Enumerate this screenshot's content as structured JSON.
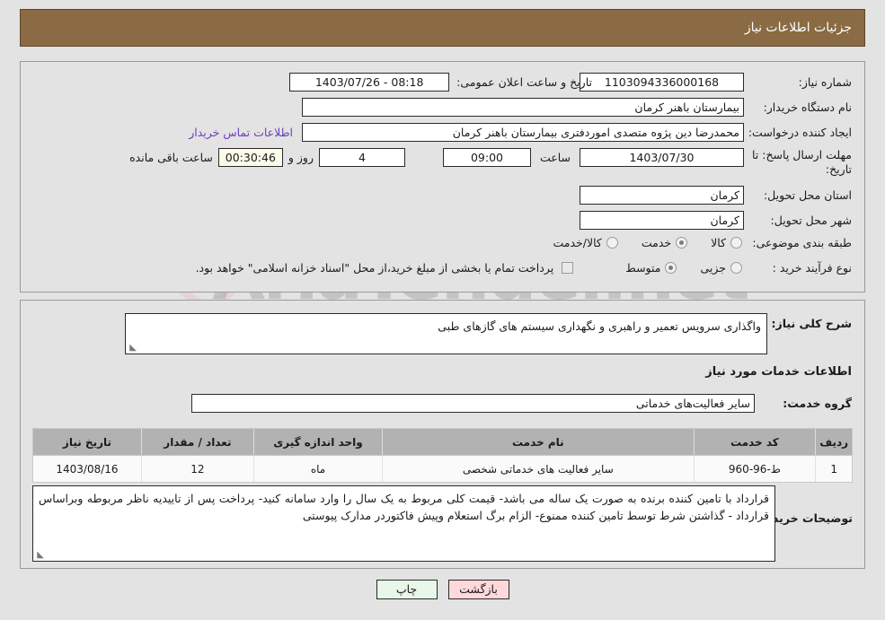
{
  "header": {
    "title": "جزئیات اطلاعات نیاز"
  },
  "watermark": {
    "text": "AriaTender.net",
    "logo_color": "#e8a0a0",
    "text_color": "#9a9a9a"
  },
  "colors": {
    "header_bg": "#8a6b44",
    "panel_bg": "#e3e3e3",
    "table_header_bg": "#b2b2b2",
    "link": "#6a3fc0",
    "timer_bg": "#fbfbe8",
    "print_button_bg": "#e9f7e9",
    "back_button_bg": "#ffd9d9"
  },
  "top_panel": {
    "need_number": {
      "label": "شماره نیاز:",
      "value": "1103094336000168"
    },
    "announce_datetime": {
      "label": "تاریخ و ساعت اعلان عمومی:",
      "value": "08:18 - 1403/07/26"
    },
    "buyer_org": {
      "label": "نام دستگاه خریدار:",
      "value": "بیمارستان باهنر کرمان"
    },
    "request_creator": {
      "label": "ایجاد کننده درخواست:",
      "value": "محمدرضا  دین پژوه متصدی اموردفتری بیمارستان باهنر کرمان"
    },
    "contact_link": "اطلاعات تماس خریدار",
    "response_deadline": {
      "label": "مهلت ارسال پاسخ: تا تاریخ:",
      "date": "1403/07/30",
      "time_label": "ساعت",
      "time": "09:00",
      "days": "4",
      "days_label": "روز و",
      "countdown": "00:30:46",
      "countdown_label": "ساعت باقی مانده"
    },
    "delivery_province": {
      "label": "استان محل تحویل:",
      "value": "کرمان"
    },
    "delivery_city": {
      "label": "شهر محل تحویل:",
      "value": "کرمان"
    },
    "subject_category": {
      "label": "طبقه بندی موضوعی:",
      "options": [
        {
          "label": "کالا",
          "selected": false
        },
        {
          "label": "خدمت",
          "selected": true
        },
        {
          "label": "کالا/خدمت",
          "selected": false
        }
      ]
    },
    "purchase_process": {
      "label": "نوع فرآیند خرید :",
      "options": [
        {
          "label": "جزیی",
          "selected": false
        },
        {
          "label": "متوسط",
          "selected": true
        }
      ]
    },
    "treasury_note": {
      "checked": false,
      "text": "پرداخت تمام یا بخشی از مبلغ خرید،از محل \"اسناد خزانه اسلامی\" خواهد بود."
    }
  },
  "bottom_panel": {
    "general_description": {
      "label": "شرح کلی نیاز:",
      "value": "واگذاری سرویس تعمیر و راهبری و نگهداری سیستم های گازهای طبی"
    },
    "services_section_title": "اطلاعات خدمات مورد نیاز",
    "service_group": {
      "label": "گروه خدمت:",
      "value": "سایر فعالیت‌های خدماتی"
    },
    "table": {
      "columns": [
        "ردیف",
        "کد خدمت",
        "نام خدمت",
        "واحد اندازه گیری",
        "تعداد / مقدار",
        "تاریخ نیاز"
      ],
      "rows": [
        {
          "row_no": "1",
          "service_code": "ط-96-960",
          "service_name": "سایر فعالیت های خدماتی شخصی",
          "unit": "ماه",
          "quantity": "12",
          "need_date": "1403/08/16"
        }
      ]
    },
    "buyer_notes": {
      "label": "توضیحات خریدار:",
      "value": "قرارداد با تامین کننده برنده به صورت یک ساله می باشد- قیمت کلی مربوط به یک سال را وارد سامانه کنید- پرداخت پس از تاییدیه ناظر مربوطه وبراساس قرارداد - گذاشتن شرط توسط تامین کننده ممنوع- الزام برگ استعلام وپیش فاکتوردر مدارک پیوستی"
    }
  },
  "footer": {
    "print_label": "چاپ",
    "back_label": "بازگشت"
  }
}
